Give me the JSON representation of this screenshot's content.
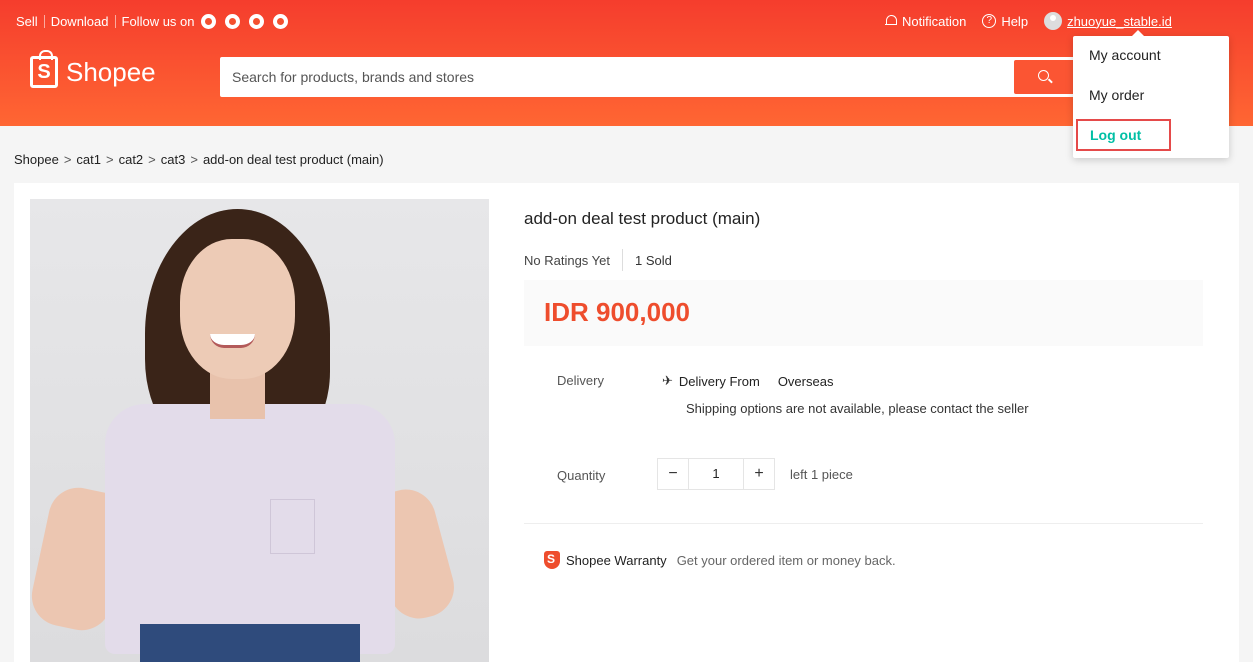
{
  "topbar": {
    "sell": "Sell",
    "download": "Download",
    "follow": "Follow us on",
    "social_icons": [
      "facebook-icon",
      "instagram-icon",
      "line-icon",
      "chat-icon"
    ],
    "notification": "Notification",
    "help": "Help",
    "help_glyph": "?",
    "username": "zhuoyue_stable.id"
  },
  "brand": {
    "name": "Shopee",
    "bag_letter": "S",
    "color": "#ee4d2d"
  },
  "search": {
    "placeholder": "Search for products, brands and stores"
  },
  "breadcrumb": [
    "Shopee",
    "cat1",
    "cat2",
    "cat3",
    "add-on deal test product (main)"
  ],
  "breadcrumb_sep": ">",
  "product": {
    "title": "add-on deal test product (main)",
    "ratings": "No Ratings Yet",
    "sold_count": "1",
    "sold_label": "Sold",
    "price": "IDR 900,000",
    "delivery_label": "Delivery",
    "delivery_from_label": "Delivery From",
    "delivery_from_value": "Overseas",
    "shipping_note": "Shipping options are not available, please contact the seller",
    "quantity_label": "Quantity",
    "quantity_value": "1",
    "minus": "−",
    "plus": "+",
    "stock_note": "left 1 piece",
    "warranty_name": "Shopee Warranty",
    "warranty_text": "Get your ordered item or money back."
  },
  "account_menu": {
    "items": [
      "My account",
      "My order",
      "Log out"
    ],
    "logout_color": "#00bfa5"
  }
}
